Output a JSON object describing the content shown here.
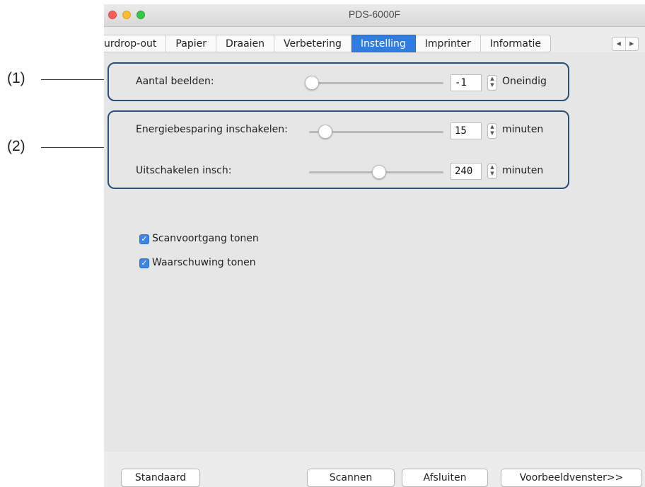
{
  "callouts": {
    "one": "(1)",
    "two": "(2)"
  },
  "window": {
    "title": "PDS-6000F"
  },
  "tabs": [
    {
      "label": "urdrop-out"
    },
    {
      "label": "Papier"
    },
    {
      "label": "Draaien"
    },
    {
      "label": "Verbetering"
    },
    {
      "label": "Instelling",
      "active": true
    },
    {
      "label": "Imprinter"
    },
    {
      "label": "Informatie"
    }
  ],
  "tab_scroll": {
    "left_icon": "triangle-left-icon",
    "right_icon": "triangle-right-icon"
  },
  "settings": {
    "aantal": {
      "label": "Aantal beelden:",
      "value": "-1",
      "unit": "Oneindig",
      "level": 0.02
    },
    "energie": {
      "label": "Energiebesparing inschakelen:",
      "value": "15",
      "unit": "minuten",
      "level": 0.12
    },
    "uit": {
      "label": "Uitschakelen insch:",
      "value": "240",
      "unit": "minuten",
      "level": 0.52
    }
  },
  "checkboxes": [
    {
      "label": "Scanvoortgang tonen",
      "checked": true
    },
    {
      "label": "Waarschuwing tonen",
      "checked": true
    }
  ],
  "buttons": {
    "standaard": "Standaard",
    "scannen": "Scannen",
    "afsluiten": "Afsluiten",
    "voorbeeld": "Voorbeeldvenster>>"
  },
  "colors": {
    "accent": "#2f7de0",
    "callout_border": "#2a4f7a",
    "close": "#fc5f57",
    "minimize": "#fdbc2e",
    "zoom": "#33c848"
  }
}
